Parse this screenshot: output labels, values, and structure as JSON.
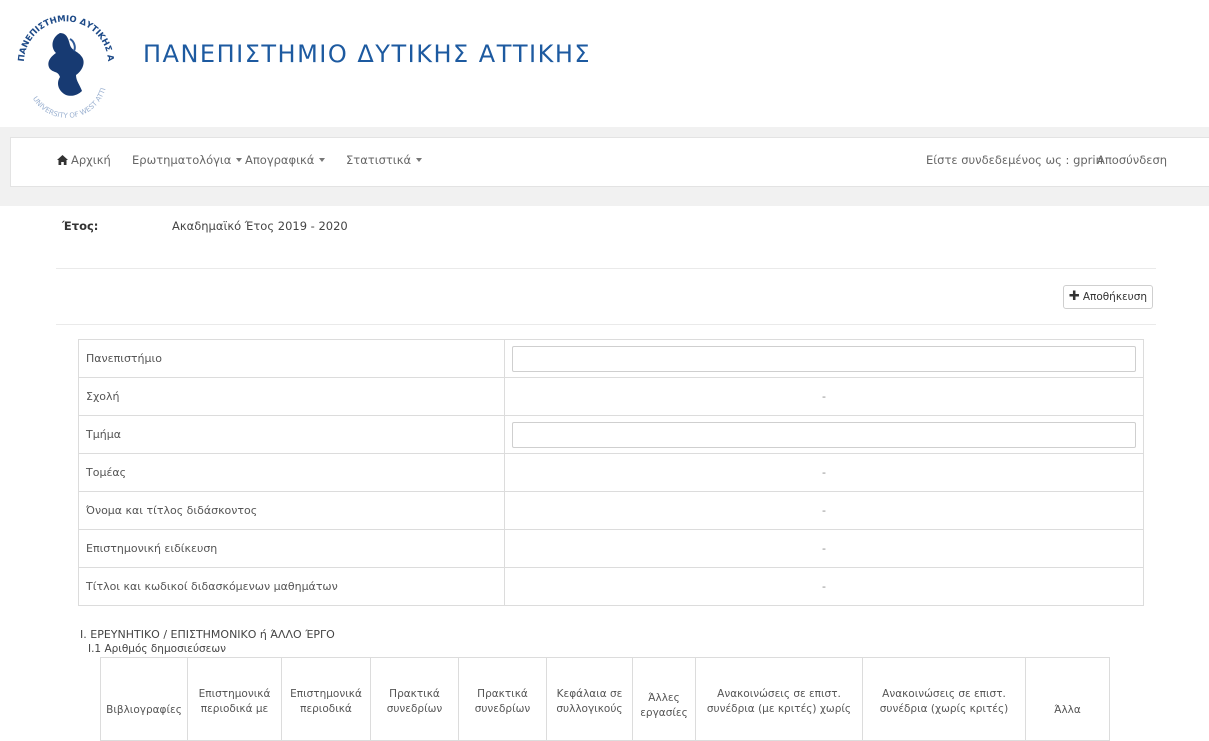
{
  "header": {
    "title": "ΠΑΝΕΠΙΣΤΗΜΙΟ ΔΥΤΙΚΗΣ ΑΤΤΙΚΗΣ",
    "logo_text_top": "ΠΑΝΕΠΙΣΤΗΜΙΟ ΔΥΤΙΚΗΣ ΑΤΤΙΚΗΣ",
    "logo_text_bottom": "UNIVERSITY OF WEST ATTICA",
    "brand_color": "#1d5aa0"
  },
  "nav": {
    "home": "Αρχική",
    "questionnaires": "Ερωτηματολόγια",
    "inventories": "Απογραφικά",
    "statistics": "Στατιστικά",
    "logged_in": "Είστε συνδεδεμένος ως : gprin",
    "logout": "Αποσύνδεση"
  },
  "year": {
    "label": "Έτος:",
    "value": "Ακαδημαϊκό Έτος 2019 - 2020"
  },
  "save_button": "Αποθήκευση",
  "info_rows": [
    {
      "label": "Πανεπιστήμιο",
      "type": "input",
      "value": ""
    },
    {
      "label": "Σχολή",
      "type": "text",
      "value": "-"
    },
    {
      "label": "Τμήμα",
      "type": "input",
      "value": ""
    },
    {
      "label": "Τομέας",
      "type": "text",
      "value": "-"
    },
    {
      "label": "Όνομα και τίτλος διδάσκοντος",
      "type": "text",
      "value": "-"
    },
    {
      "label": "Επιστημονική ειδίκευση",
      "type": "text",
      "value": "-"
    },
    {
      "label": "Τίτλοι και κωδικοί διδασκόμενων μαθημάτων",
      "type": "text",
      "value": "-"
    }
  ],
  "section": {
    "title": "Ι. ΕΡΕΥΝΗΤΙΚΟ / ΕΠΙΣΤΗΜΟΝΙΚΟ ή ΆΛΛΟ ΈΡΓΟ",
    "subtitle": "Ι.1 Αριθμός δημοσιεύσεων"
  },
  "pub_columns": [
    "Βιβλιογραφίες",
    "Επιστημονικά περιοδικά με",
    "Επιστημονικά περιοδικά",
    "Πρακτικά συνεδρίων",
    "Πρακτικά συνεδρίων",
    "Κεφάλαια σε συλλογικούς",
    "Άλλες εργασίες",
    "Ανακοινώσεις σε επιστ. συνέδρια (με κριτές) χωρίς",
    "Ανακοινώσεις σε επιστ. συνέδρια (χωρίς κριτές)",
    "Άλλα"
  ]
}
